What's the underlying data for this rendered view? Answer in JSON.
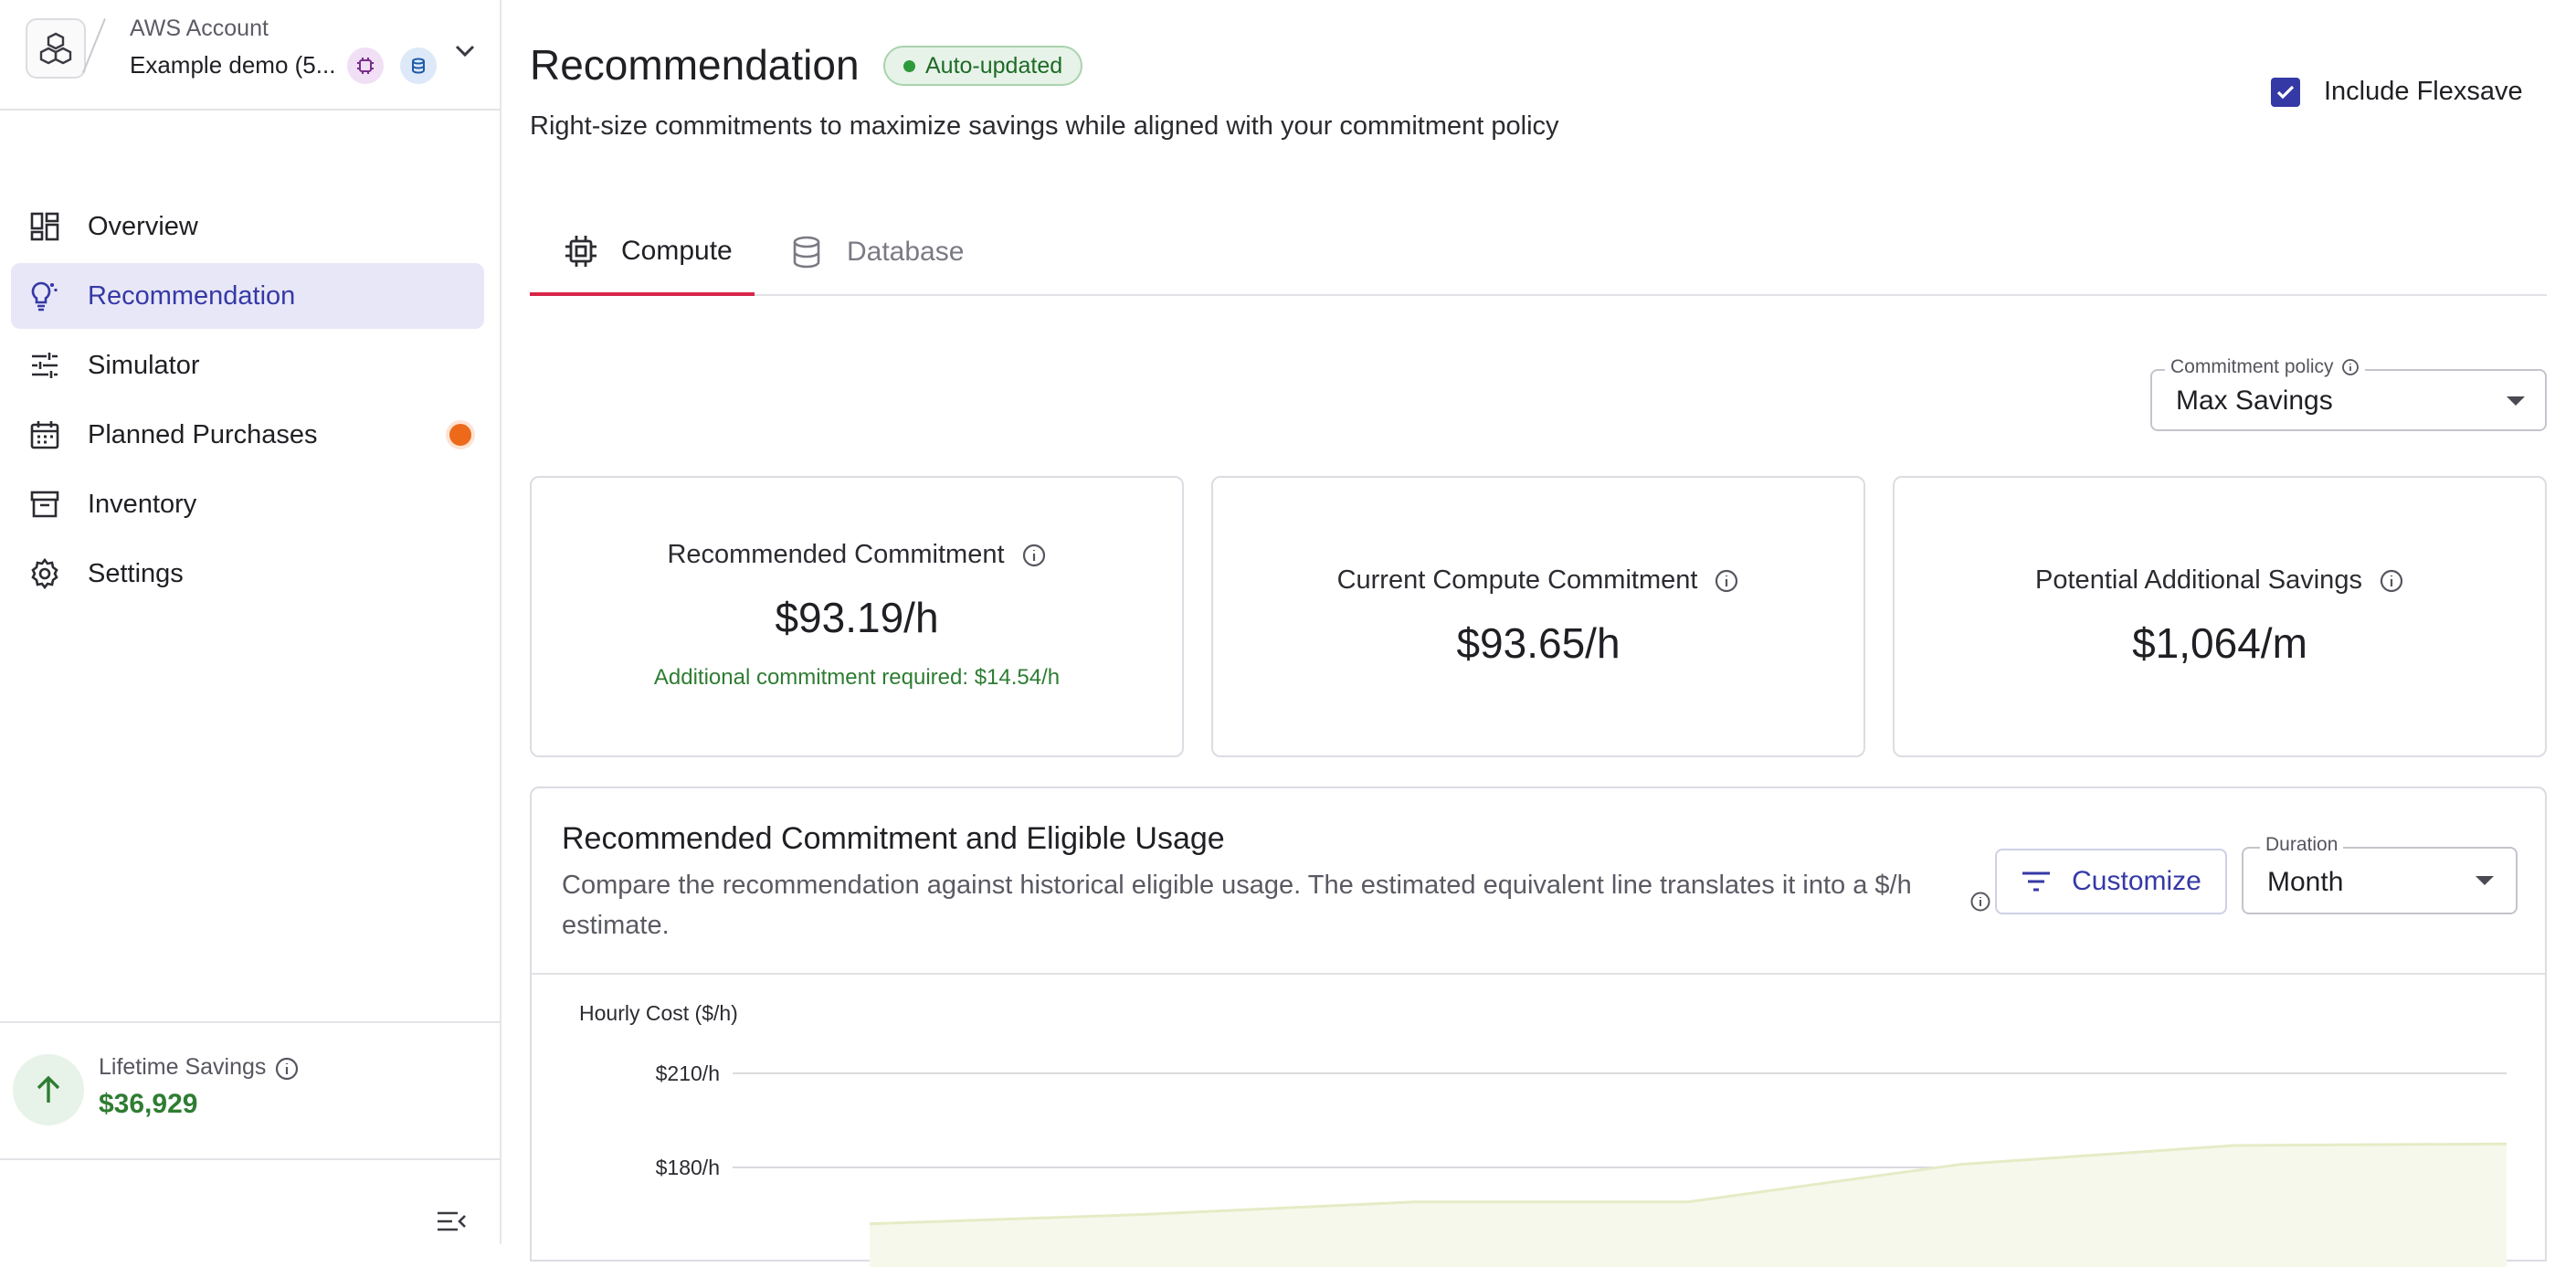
{
  "account": {
    "label": "AWS Account",
    "name": "Example demo (5..."
  },
  "sidebar": {
    "items": [
      {
        "label": "Overview",
        "icon": "dashboard-icon"
      },
      {
        "label": "Recommendation",
        "icon": "lightbulb-icon",
        "active": true
      },
      {
        "label": "Simulator",
        "icon": "sliders-icon"
      },
      {
        "label": "Planned Purchases",
        "icon": "calendar-icon",
        "indicator": "#ec6a1a"
      },
      {
        "label": "Inventory",
        "icon": "archive-icon"
      },
      {
        "label": "Settings",
        "icon": "gear-icon"
      }
    ],
    "lifetime_savings": {
      "label": "Lifetime Savings",
      "value": "$36,929"
    }
  },
  "header": {
    "title": "Recommendation",
    "badge": "Auto-updated",
    "subtitle": "Right-size commitments to maximize savings while aligned with your commitment policy",
    "flexsave": {
      "label": "Include Flexsave",
      "checked": true
    }
  },
  "tabs": [
    {
      "label": "Compute",
      "icon": "cpu-icon",
      "selected": true
    },
    {
      "label": "Database",
      "icon": "database-icon",
      "selected": false
    }
  ],
  "commitment_policy": {
    "label": "Commitment policy",
    "value": "Max Savings"
  },
  "cards": [
    {
      "title": "Recommended Commitment",
      "value": "$93.19/h",
      "note": "Additional commitment required: $14.54/h"
    },
    {
      "title": "Current Compute Commitment",
      "value": "$93.65/h"
    },
    {
      "title": "Potential Additional Savings",
      "value": "$1,064/m"
    }
  ],
  "usage_panel": {
    "title": "Recommended Commitment and Eligible Usage",
    "description": "Compare the recommendation against historical eligible usage. The estimated equivalent line translates it into a $/h estimate.",
    "customize_label": "Customize",
    "duration": {
      "label": "Duration",
      "value": "Month"
    }
  },
  "chart_data": {
    "type": "area",
    "ylabel": "Hourly Cost ($/h)",
    "y_ticks": [
      "$210/h",
      "$180/h"
    ],
    "ytick_values": [
      210,
      180
    ],
    "ylim": [
      150,
      210
    ],
    "grid": true,
    "series": [
      {
        "values": [
          162,
          165,
          169,
          169,
          181,
          187,
          187.5
        ]
      }
    ],
    "colors": {
      "fill": "#f7f8ec",
      "line": "#e6ebc6",
      "grid": "#d9d9de"
    }
  }
}
